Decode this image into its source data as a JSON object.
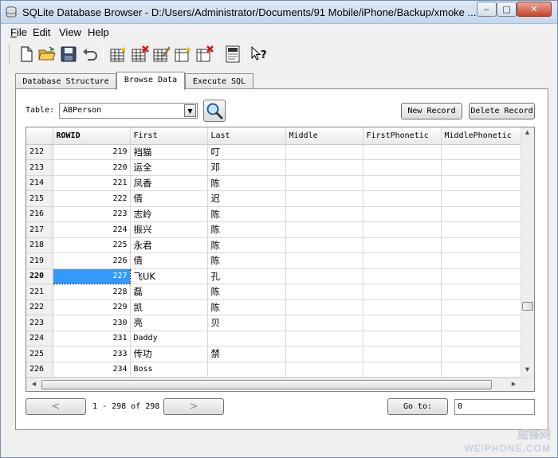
{
  "window": {
    "title": "SQLite Database Browser - D:/Users/Administrator/Documents/91 Mobile/iPhone/Backup/xmoke ...",
    "minimize": "‒",
    "maximize": "□",
    "close": "✕"
  },
  "menu": [
    {
      "label_u": "F",
      "label_rest": "ile"
    },
    {
      "label_u": "",
      "label_rest": "Edit"
    },
    {
      "label_u": "",
      "label_rest": "View"
    },
    {
      "label_u": "",
      "label_rest": "Help"
    }
  ],
  "toolbar": {
    "icons": [
      "new-file-icon",
      "open-folder-icon",
      "save-icon",
      "undo-icon",
      "create-table-icon",
      "delete-table-icon",
      "modify-table-icon",
      "create-index-icon",
      "delete-index-icon",
      "sql-log-icon",
      "whats-this-icon"
    ]
  },
  "tabs": [
    {
      "label": "Database Structure"
    },
    {
      "label": "Browse Data"
    },
    {
      "label": "Execute SQL"
    }
  ],
  "browse": {
    "table_label": "Table:",
    "table_value": "ABPerson",
    "new_record": "New Record",
    "delete_record": "Delete Record"
  },
  "grid": {
    "columns": [
      "ROWID",
      "First",
      "Last",
      "Middle",
      "FirstPhonetic",
      "MiddlePhonetic"
    ],
    "rows": [
      {
        "num": "212",
        "rowid": "219",
        "first": "裆猫",
        "last": "叮"
      },
      {
        "num": "213",
        "rowid": "220",
        "first": "运全",
        "last": "邓"
      },
      {
        "num": "214",
        "rowid": "221",
        "first": "凤香",
        "last": "陈"
      },
      {
        "num": "215",
        "rowid": "222",
        "first": "倩",
        "last": "迟"
      },
      {
        "num": "216",
        "rowid": "223",
        "first": "志岭",
        "last": "陈"
      },
      {
        "num": "217",
        "rowid": "224",
        "first": "振兴",
        "last": "陈"
      },
      {
        "num": "218",
        "rowid": "225",
        "first": "永君",
        "last": "陈"
      },
      {
        "num": "219",
        "rowid": "226",
        "first": "倩",
        "last": "陈"
      },
      {
        "num": "220",
        "rowid": "227",
        "first": "飞UK",
        "last": "孔"
      },
      {
        "num": "221",
        "rowid": "228",
        "first": "磊",
        "last": "陈"
      },
      {
        "num": "222",
        "rowid": "229",
        "first": "凯",
        "last": "陈"
      },
      {
        "num": "223",
        "rowid": "230",
        "first": "亮",
        "last": "贝"
      },
      {
        "num": "224",
        "rowid": "231",
        "first": "Daddy",
        "last": ""
      },
      {
        "num": "225",
        "rowid": "233",
        "first": "传功",
        "last": "禁"
      },
      {
        "num": "226",
        "rowid": "234",
        "first": "Boss",
        "last": ""
      }
    ]
  },
  "nav": {
    "prev": "<",
    "next": ">",
    "range": "1 - 298 of 298",
    "goto_label": "Go to:",
    "goto_value": "0"
  },
  "watermark": {
    "line1": "威锋网",
    "line2": "WEIPHONE.COM"
  }
}
